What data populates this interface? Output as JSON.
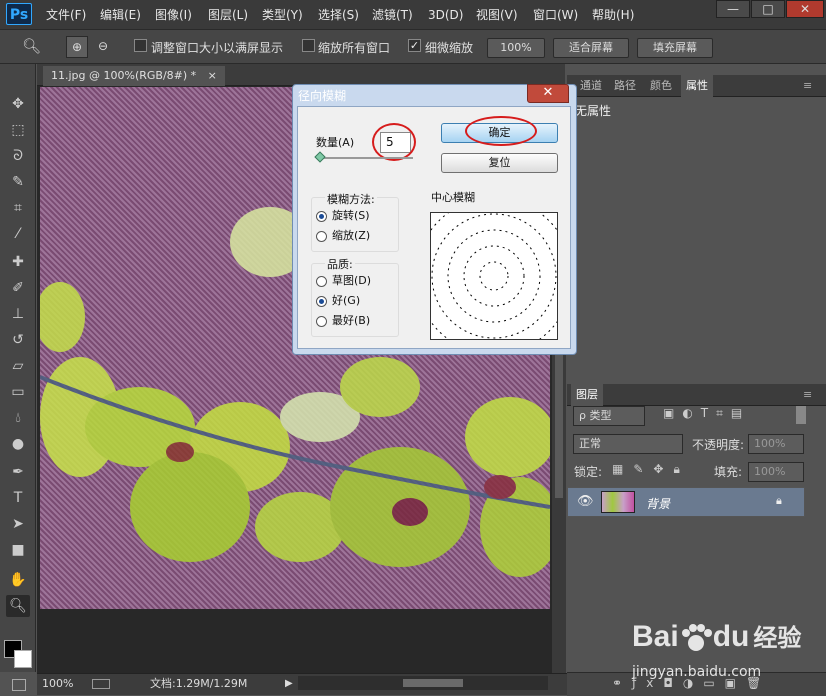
{
  "app": {
    "logo": "Ps"
  },
  "menu": [
    "文件(F)",
    "编辑(E)",
    "图像(I)",
    "图层(L)",
    "类型(Y)",
    "选择(S)",
    "滤镜(T)",
    "3D(D)",
    "视图(V)",
    "窗口(W)",
    "帮助(H)"
  ],
  "window_controls": {
    "minimize": "—",
    "restore": "□",
    "close": "✕"
  },
  "options": {
    "cb1": "调整窗口大小以满屏显示",
    "cb2": "缩放所有窗口",
    "cb3": "细微缩放",
    "zoom_btn": "100%",
    "fit_btn": "适合屏幕",
    "fill_btn": "填充屏幕"
  },
  "doc": {
    "tab": "11.jpg @ 100%(RGB/8#) *",
    "close": "×"
  },
  "status": {
    "zoom": "100%",
    "doc": "文档:1.29M/1.29M"
  },
  "panel_tabs": [
    "通道",
    "路径",
    "颜色",
    "属性"
  ],
  "props": {
    "empty": "无属性"
  },
  "layers": {
    "tab": "图层",
    "filter": "ρ 类型",
    "blend": "正常",
    "opacity_label": "不透明度:",
    "opacity": "100%",
    "lock_label": "锁定:",
    "fill_label": "填充:",
    "fill": "100%",
    "layer_name": "背景"
  },
  "dialog": {
    "title": "径向模糊",
    "amount_label": "数量(A)",
    "amount": "5",
    "ok": "确定",
    "reset": "复位",
    "method_title": "模糊方法:",
    "method_spin": "旋转(S)",
    "method_zoom": "缩放(Z)",
    "quality_title": "品质:",
    "q_draft": "草图(D)",
    "q_good": "好(G)",
    "q_best": "最好(B)",
    "center_title": "中心模糊"
  },
  "watermark": {
    "brand": "Bai",
    "brand2": "du",
    "exp": "经验",
    "url": "jingyan.baidu.com"
  }
}
